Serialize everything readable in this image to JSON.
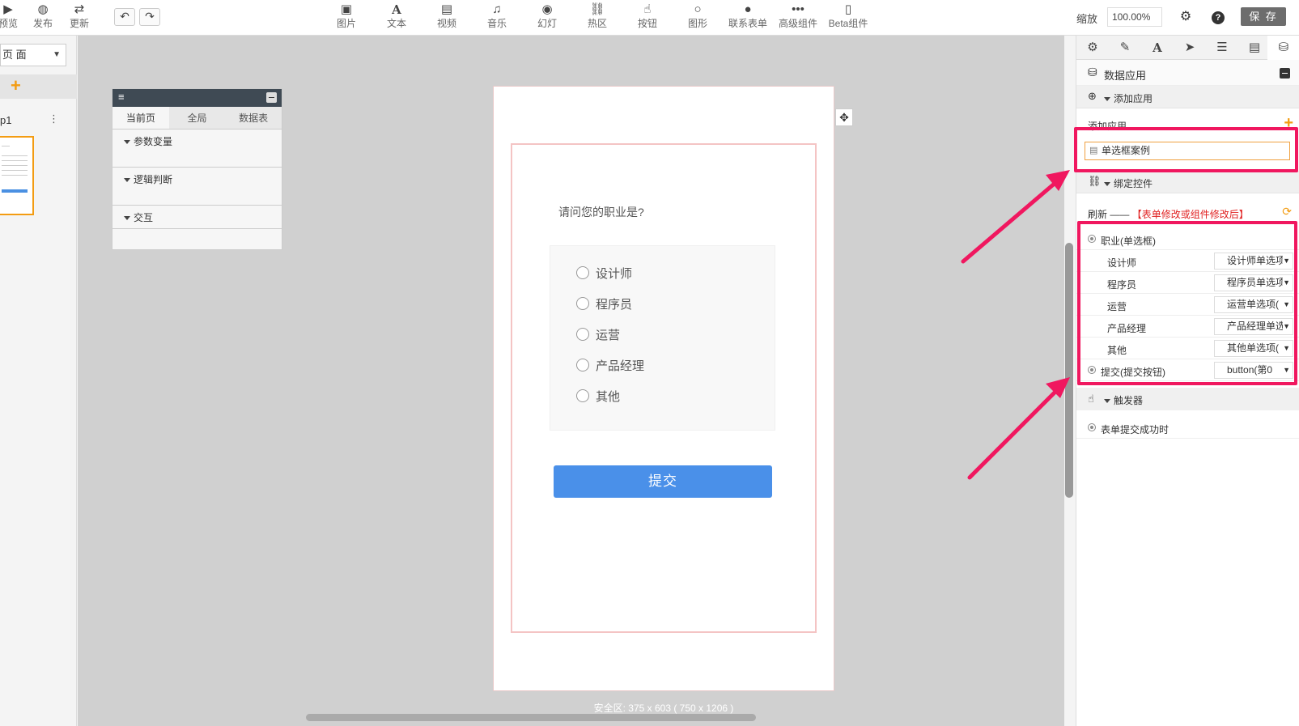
{
  "toolbar": {
    "left_buttons": [
      {
        "label": "预览",
        "icon": "preview-icon"
      },
      {
        "label": "发布",
        "icon": "wechat-icon"
      },
      {
        "label": "更新",
        "icon": "retweet-icon"
      }
    ],
    "components": [
      {
        "label": "图片",
        "icon": "image-icon"
      },
      {
        "label": "文本",
        "icon": "text-icon"
      },
      {
        "label": "视频",
        "icon": "video-icon"
      },
      {
        "label": "音乐",
        "icon": "music-icon"
      },
      {
        "label": "幻灯",
        "icon": "slideshow-icon"
      },
      {
        "label": "热区",
        "icon": "link-icon"
      },
      {
        "label": "按钮",
        "icon": "hand-icon"
      },
      {
        "label": "图形",
        "icon": "circle-icon"
      },
      {
        "label": "联系表单",
        "icon": "user-icon"
      },
      {
        "label": "高级组件",
        "icon": "more-icon"
      },
      {
        "label": "Beta组件",
        "icon": "mobile-icon"
      }
    ],
    "zoom_label": "缩放",
    "zoom_value": "100.00%",
    "save_label": "保 存"
  },
  "left": {
    "page_select": "页 面",
    "page_name": "p1"
  },
  "var_panel": {
    "tabs": [
      "当前页",
      "全局",
      "数据表"
    ],
    "sections": [
      "参数变量",
      "逻辑判断",
      "交互"
    ]
  },
  "canvas": {
    "question": "请问您的职业是?",
    "options": [
      "设计师",
      "程序员",
      "运营",
      "产品经理",
      "其他"
    ],
    "submit_label": "提交",
    "safe_area": "安全区: 375 x 603 ( 750 x 1206 )"
  },
  "right": {
    "data_app_title": "数据应用",
    "add_app_section": "添加应用",
    "add_app_label": "添加应用",
    "app_item": "单选框案例",
    "bind_section": "绑定控件",
    "refresh_label": "刷新 ——",
    "refresh_note": "【表单修改或组件修改后】",
    "bindings": [
      {
        "label": "职业(单选框)",
        "top": true,
        "value": ""
      },
      {
        "label": "设计师",
        "top": false,
        "value": "设计师单选项"
      },
      {
        "label": "程序员",
        "top": false,
        "value": "程序员单选项"
      },
      {
        "label": "运营",
        "top": false,
        "value": "运营单选项("
      },
      {
        "label": "产品经理",
        "top": false,
        "value": "产品经理单选"
      },
      {
        "label": "其他",
        "top": false,
        "value": "其他单选项("
      },
      {
        "label": "提交(提交按钮)",
        "top": true,
        "value": "button(第0"
      }
    ],
    "trigger_section": "触发器",
    "trigger_item": "表单提交成功时"
  },
  "colors": {
    "accent": "#f39c12",
    "highlight": "#f0175f",
    "submit_blue": "#4a90e9",
    "panel_dark": "#3f4a54"
  }
}
